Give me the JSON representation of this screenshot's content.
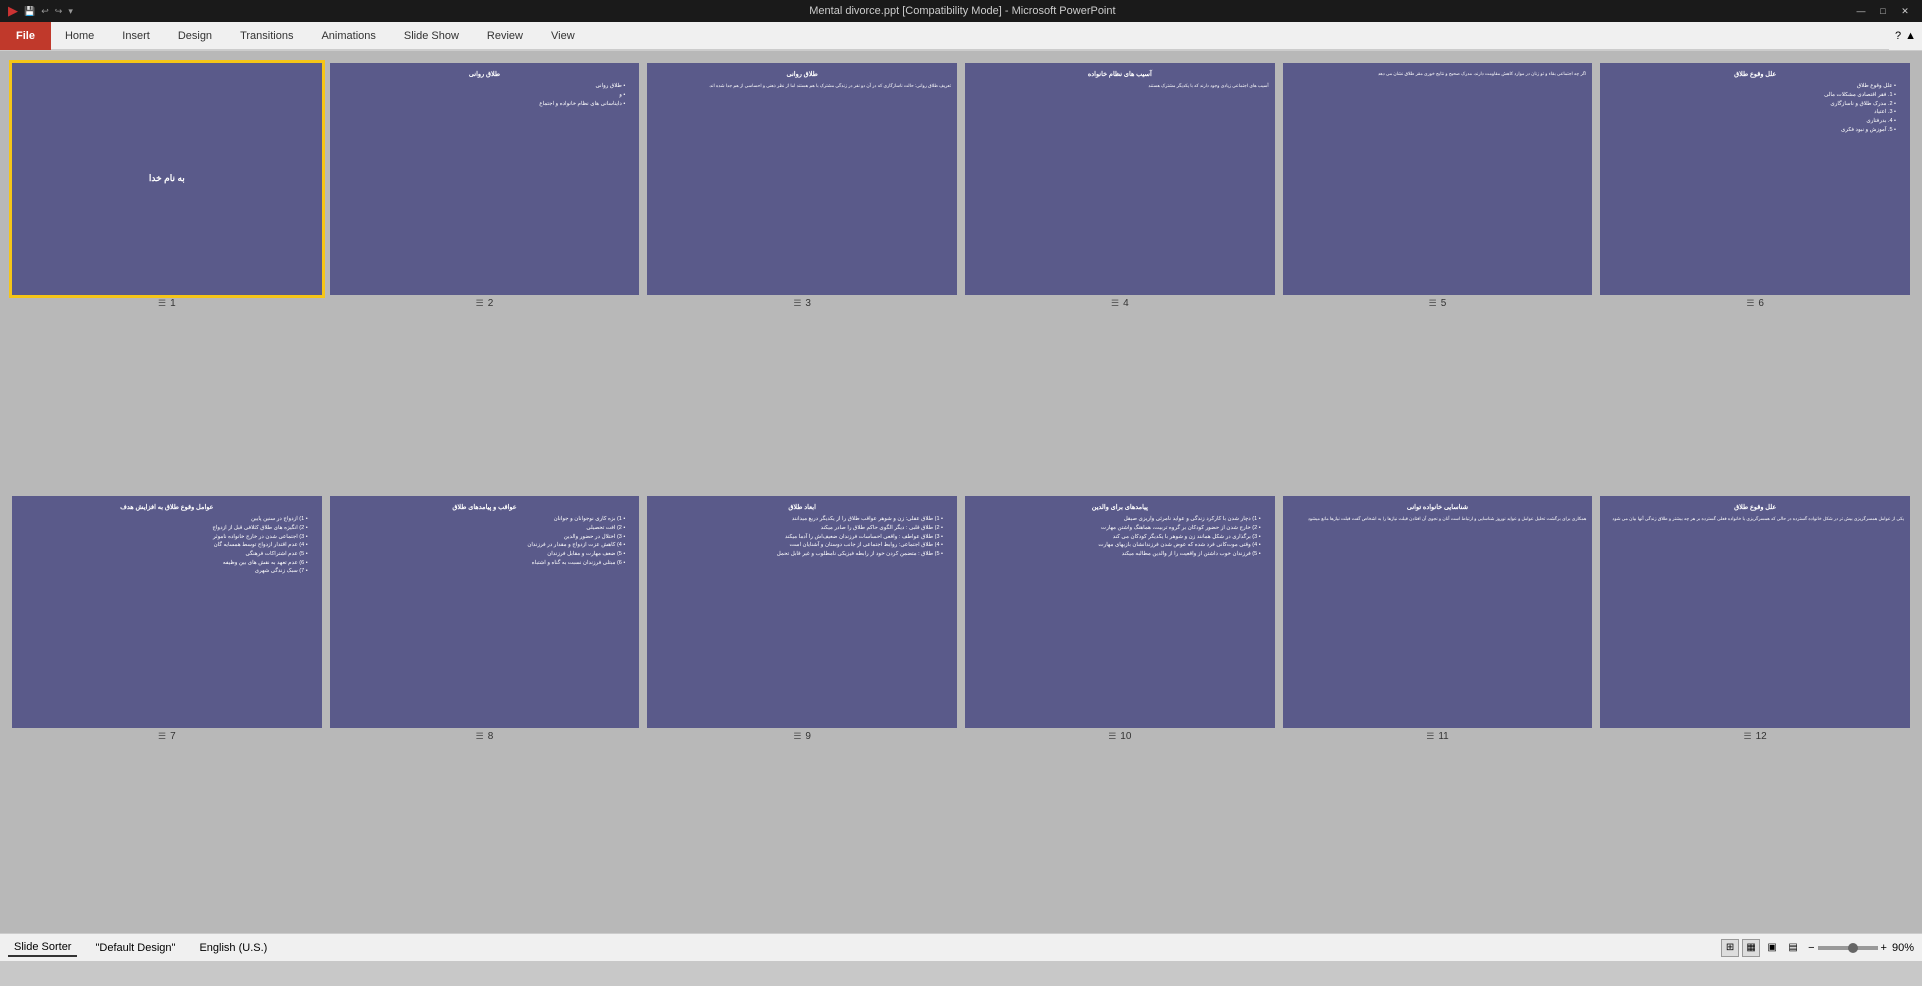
{
  "titlebar": {
    "title": "Mental divorce.ppt [Compatibility Mode] - Microsoft PowerPoint",
    "minimize": "—",
    "maximize": "□",
    "close": "✕"
  },
  "qat": {
    "file_label": "File",
    "save_icon": "💾",
    "undo_icon": "↩",
    "redo_icon": "↪"
  },
  "ribbon": {
    "tabs": [
      {
        "id": "home",
        "label": "Home",
        "active": false
      },
      {
        "id": "insert",
        "label": "Insert",
        "active": false
      },
      {
        "id": "design",
        "label": "Design",
        "active": false
      },
      {
        "id": "transitions",
        "label": "Transitions",
        "active": false
      },
      {
        "id": "animations",
        "label": "Animations",
        "active": false
      },
      {
        "id": "slideshow",
        "label": "Slide Show",
        "active": false
      },
      {
        "id": "review",
        "label": "Review",
        "active": false
      },
      {
        "id": "view",
        "label": "View",
        "active": false
      }
    ]
  },
  "slides": [
    {
      "number": "1",
      "selected": true,
      "title": "به نام خدا",
      "content_type": "title_only"
    },
    {
      "number": "2",
      "selected": false,
      "title": "طلاق روانی",
      "bullets": [
        "طلاق روانی",
        "و",
        "دایناسانی های نظام خانواده و اجتماع"
      ],
      "content_type": "bullets"
    },
    {
      "number": "3",
      "selected": false,
      "title": "طلاق روانی",
      "content": "تعریف طلاق روانی: حالت ناسازگاری که در آن دو نفر در زندگی مشترک با هم هستند اما از نظر ذهنی و احساسی از هم جدا شده اند.",
      "content_type": "text_heavy"
    },
    {
      "number": "4",
      "selected": false,
      "title": "آسیب های نظام خانواده",
      "content": "آسیب های اجتماعی زیادی وجود دارند که با یکدیگر مشترک هستند",
      "content_type": "text_heavy"
    },
    {
      "number": "5",
      "selected": false,
      "title": "",
      "content": "اگر چه اجتماعی بقاء و تو زنان در موارد کاهش مقاومت دارند، مدرک صحیح و نتایج خوری مقر طلاق نشان می دهد",
      "content_type": "text_heavy"
    },
    {
      "number": "6",
      "selected": false,
      "title": "علل وقوع طلاق",
      "bullets": [
        "علل وقوع طلاق",
        "1. فقر اقتصادی مشکلات مالی",
        "2. مدرک طلاق و ناسازگاری",
        "3. اعتیاد",
        "4. بدرفتاری",
        "5. آموزش و نبود فکری"
      ],
      "content_type": "bullets"
    },
    {
      "number": "7",
      "selected": false,
      "title": "عوامل وقوع طلاق به افزایش هدف",
      "bullets": [
        "1) ازدواج در سنین پایین",
        "2) انگیزه های طلاق کثلافی قبل از ازدواج",
        "3) اجتماعی شدن در خارج خانواده ناموثر",
        "4) عدم اقتدار ازدواج توسط همسایه گان",
        "5) عدم اشتراکات فرهنگی",
        "6) عدم تعهد به نقش های بین وظیفه",
        "7) سبک زندگی شهری"
      ],
      "content_type": "bullets"
    },
    {
      "number": "8",
      "selected": false,
      "title": "عواقب و پیامدهای طلاق",
      "bullets": [
        "1) بزه کاری نوجوانان و جوانان",
        "2) افت تحصیلی",
        "3) اختلال در حضور والدین",
        "4) کاهش عزت ازدواج و مقدار در فرزندان",
        "5) ضعف مهارت و مقابل فرزندان",
        "6) مبتلی فرزندان نسبت به گناه و اشتباه"
      ],
      "content_type": "bullets"
    },
    {
      "number": "9",
      "selected": false,
      "title": "ابعاد طلاق",
      "bullets": [
        "1) طلاق عقلی: زن و شوهر عواقب طلاق را از یکدیگر دریغ میدانند",
        "2) طلاق قلبی : دیگر الگوی حاکم طلاق را صادر میکند",
        "3) طلاق عواطف : واقعی احساسات فرزندان ضعیف‌اش را آدما میکند",
        "4) طلاق اجتماعی: روابط اجتماعی از جانب دوستان و آشنایان است",
        "5) طلاق : متضمن کردن خود از رابطه فیزیکی نامطلوب و غیر قابل تحمل"
      ],
      "content_type": "bullets"
    },
    {
      "number": "10",
      "selected": false,
      "title": "پیامدهای برای والدین",
      "bullets": [
        "1) دچار شدن با کارکرد زندگی و عواید نامرئی واریزی صیقل",
        "2) خارج شدن از حضور کودکان بر گروه تربیت، هماهنگ واشتن مهارت",
        "3) برگذاری در شکل همانند زن و شوهر با یکدیگر کودکان می کند",
        "4) وقتی موت‌کانی فرد شده که عوض شدن فرزندانشان بازیهای مهارت",
        "5) فرزندان خوب داشتن از واقعیت را از والدین مطالبه میکند"
      ],
      "content_type": "bullets"
    },
    {
      "number": "11",
      "selected": false,
      "title": "شناسایی خانواده توانی",
      "content": "همکاری برای برگشت تحلیل عوامل و عواید نوروز شناسایی و ارتباط است آنان و نجوی آن افتادن قبلت نیازها را به اشخاص گفت قبلت نیازها مانع میشود",
      "content_type": "text_heavy"
    },
    {
      "number": "12",
      "selected": false,
      "title": "علل وقوع طلاق",
      "content": "یکی از عوامل همسرگریزی بیش تر در شکل خانواده گسترده در حالی که همسرگریزی با خانواده فعلی گسترده بر هر چه بیشتر و طلاق زندگی آنها بیان می شود",
      "content_type": "text_heavy"
    }
  ],
  "statusbar": {
    "slide_sorter": "Slide Sorter",
    "default_design": "\"Default Design\"",
    "language": "English (U.S.)",
    "zoom_level": "90%",
    "view_icons": [
      "▦",
      "▣",
      "⊞",
      "▤"
    ]
  },
  "colors": {
    "slide_bg": "#5a5a8a",
    "selected_border": "#f5c518",
    "ribbon_active": "#c0392b",
    "file_btn": "#c0392b",
    "qat_bg": "#9e2a1b"
  }
}
